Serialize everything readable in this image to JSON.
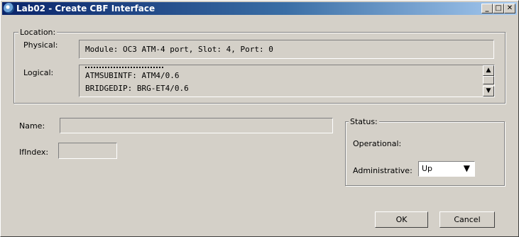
{
  "window": {
    "title": "Lab02 - Create CBF Interface",
    "controls": {
      "minimize": "_",
      "maximize": "□",
      "close": "✕"
    }
  },
  "location": {
    "legend": "Location:",
    "physical_label": "Physical:",
    "physical_value": "Module: OC3 ATM-4 port, Slot: 4, Port: 0",
    "logical_label": "Logical:",
    "logical_lines": [
      "ATMSUBINTF: ATM4/0.6",
      "BRIDGEDIP: BRG-ET4/0.6"
    ]
  },
  "form": {
    "name_label": "Name:",
    "name_value": "",
    "ifindex_label": "IfIndex:",
    "ifindex_value": ""
  },
  "status": {
    "legend": "Status:",
    "operational_label": "Operational:",
    "operational_value": "",
    "administrative_label": "Administrative:",
    "administrative_value": "Up"
  },
  "buttons": {
    "ok": "OK",
    "cancel": "Cancel"
  },
  "icons": {
    "scroll_up": "▲",
    "scroll_down": "▼",
    "dropdown": "▼"
  }
}
